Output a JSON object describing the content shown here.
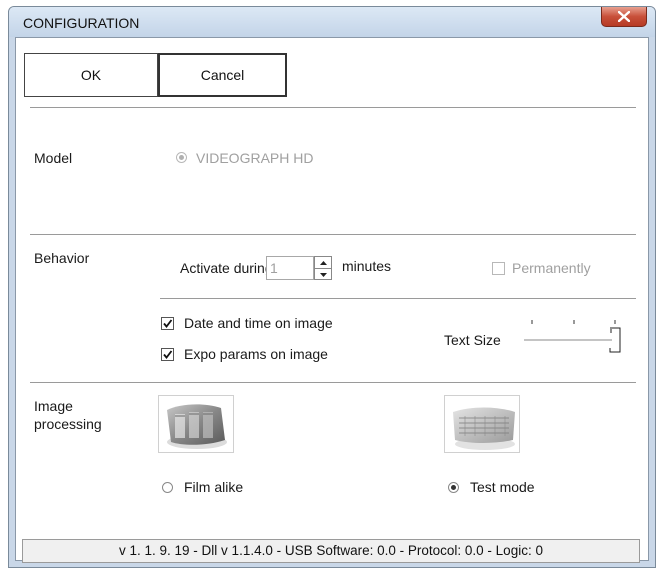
{
  "window": {
    "title": "CONFIGURATION"
  },
  "buttons": {
    "ok_label": "OK",
    "cancel_label": "Cancel"
  },
  "model": {
    "label": "Model",
    "option_label": "VIDEOGRAPH HD",
    "selected": true,
    "disabled": true
  },
  "behavior": {
    "label": "Behavior",
    "activate_label": "Activate during:",
    "activate_value": "1",
    "minutes_label": "minutes",
    "permanently_label": "Permanently",
    "permanently_checked": false,
    "date_time_label": "Date and time on image",
    "date_time_checked": true,
    "expo_label": "Expo params on image",
    "expo_checked": true,
    "text_size_label": "Text Size",
    "text_size_level": "max"
  },
  "image_processing": {
    "label_line1": "Image",
    "label_line2": "processing",
    "options": [
      {
        "label": "Film alike",
        "selected": false
      },
      {
        "label": "Test mode",
        "selected": true
      }
    ]
  },
  "status_bar": {
    "text": "v 1. 1. 9. 19 - Dll v 1.1.4.0 - USB Software: 0.0 - Protocol: 0.0 - Logic: 0"
  },
  "icons": {
    "close": "close-icon",
    "film_thumb": "film-alike-thumbnail-icon",
    "test_thumb": "test-mode-thumbnail-icon"
  },
  "colors": {
    "close_button": "#c8503a",
    "titlebar": "#c9d7e8",
    "disabled_text": "#a0a0a0"
  }
}
